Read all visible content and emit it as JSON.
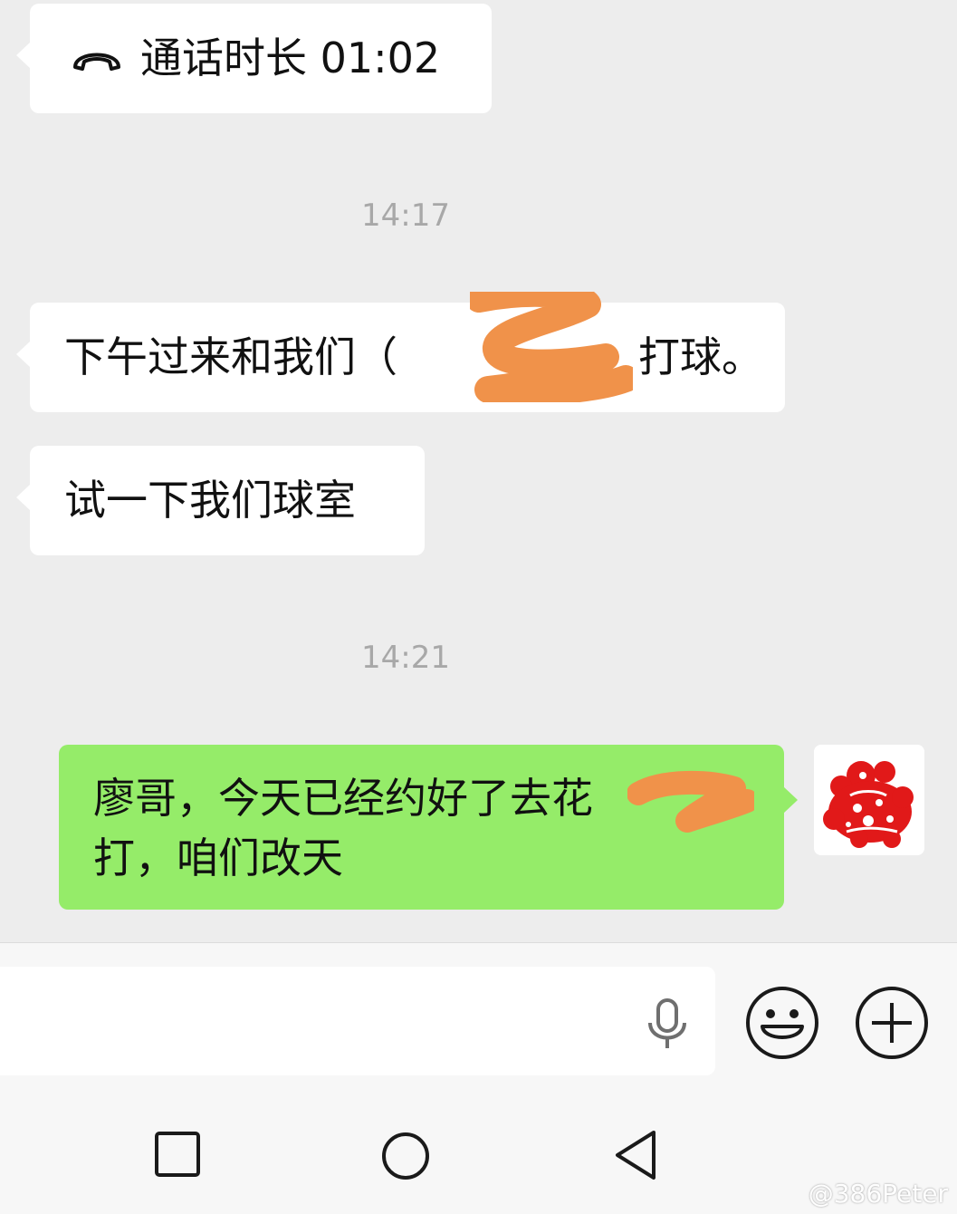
{
  "chat": {
    "call": {
      "icon": "hang-up-phone-icon",
      "text": "通话时长 01:02"
    },
    "time1": "14:17",
    "msg1": {
      "before": "下午过来和我们（",
      "after": "打球。"
    },
    "msg2": "试一下我们球室",
    "time2": "14:21",
    "msg3": {
      "line1": "廖哥，今天已经约好了去花",
      "line2": "打，咱们改天"
    },
    "redaction_color": "#f0924a",
    "avatar": "red-papercut-avatar"
  },
  "input_bar": {
    "voice_icon": "microphone-icon",
    "emoji_icon": "emoji-icon",
    "plus_icon": "plus-icon"
  },
  "nav_bar": {
    "recent_icon": "square-recents-icon",
    "home_icon": "circle-home-icon",
    "back_icon": "triangle-back-icon"
  },
  "watermark": "@386Peter"
}
